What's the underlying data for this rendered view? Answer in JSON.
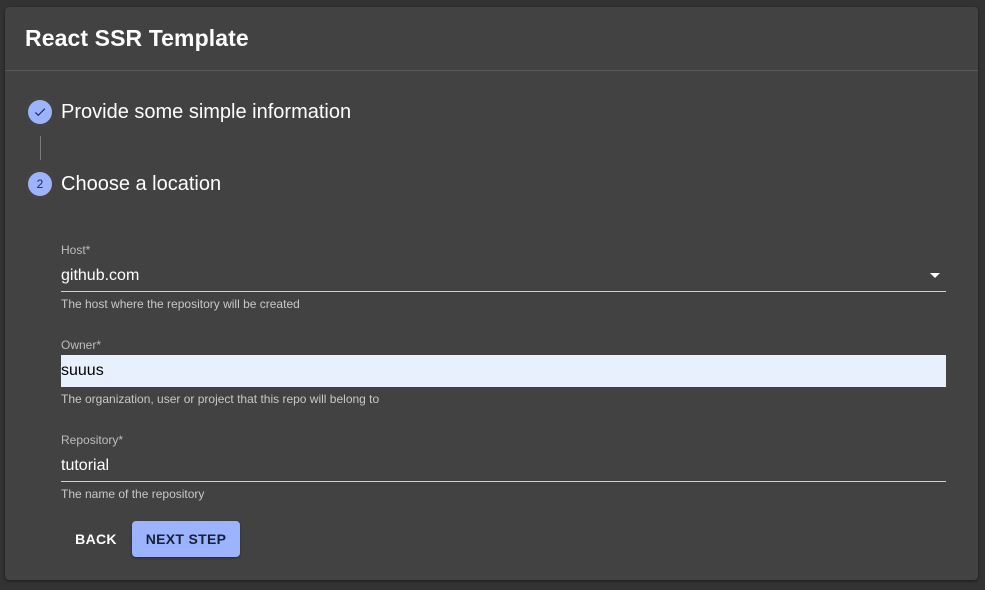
{
  "header": {
    "title": "React SSR Template"
  },
  "steps": [
    {
      "label": "Provide some simple information",
      "state": "completed",
      "icon": "check-icon"
    },
    {
      "label": "Choose a location",
      "state": "active",
      "number": "2"
    }
  ],
  "form": {
    "host": {
      "label": "Host*",
      "value": "github.com",
      "helper": "The host where the repository will be created"
    },
    "owner": {
      "label": "Owner*",
      "value": "suuus",
      "helper": "The organization, user or project that this repo will belong to"
    },
    "repository": {
      "label": "Repository*",
      "value": "tutorial",
      "helper": "The name of the repository"
    }
  },
  "actions": {
    "back_label": "BACK",
    "next_label": "NEXT STEP"
  },
  "colors": {
    "accent": "#9cb4ff",
    "card_background": "#424242",
    "page_background": "#333333",
    "autofill_background": "#e8f0fe"
  }
}
